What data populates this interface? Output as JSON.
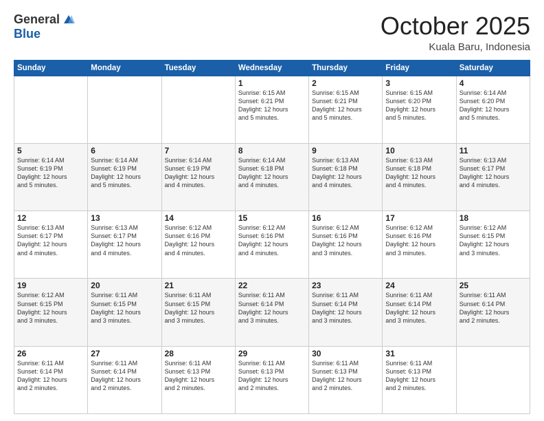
{
  "header": {
    "logo_general": "General",
    "logo_blue": "Blue",
    "month_title": "October 2025",
    "location": "Kuala Baru, Indonesia"
  },
  "days_of_week": [
    "Sunday",
    "Monday",
    "Tuesday",
    "Wednesday",
    "Thursday",
    "Friday",
    "Saturday"
  ],
  "weeks": [
    [
      {
        "day": "",
        "info": ""
      },
      {
        "day": "",
        "info": ""
      },
      {
        "day": "",
        "info": ""
      },
      {
        "day": "1",
        "info": "Sunrise: 6:15 AM\nSunset: 6:21 PM\nDaylight: 12 hours\nand 5 minutes."
      },
      {
        "day": "2",
        "info": "Sunrise: 6:15 AM\nSunset: 6:21 PM\nDaylight: 12 hours\nand 5 minutes."
      },
      {
        "day": "3",
        "info": "Sunrise: 6:15 AM\nSunset: 6:20 PM\nDaylight: 12 hours\nand 5 minutes."
      },
      {
        "day": "4",
        "info": "Sunrise: 6:14 AM\nSunset: 6:20 PM\nDaylight: 12 hours\nand 5 minutes."
      }
    ],
    [
      {
        "day": "5",
        "info": "Sunrise: 6:14 AM\nSunset: 6:19 PM\nDaylight: 12 hours\nand 5 minutes."
      },
      {
        "day": "6",
        "info": "Sunrise: 6:14 AM\nSunset: 6:19 PM\nDaylight: 12 hours\nand 5 minutes."
      },
      {
        "day": "7",
        "info": "Sunrise: 6:14 AM\nSunset: 6:19 PM\nDaylight: 12 hours\nand 4 minutes."
      },
      {
        "day": "8",
        "info": "Sunrise: 6:14 AM\nSunset: 6:18 PM\nDaylight: 12 hours\nand 4 minutes."
      },
      {
        "day": "9",
        "info": "Sunrise: 6:13 AM\nSunset: 6:18 PM\nDaylight: 12 hours\nand 4 minutes."
      },
      {
        "day": "10",
        "info": "Sunrise: 6:13 AM\nSunset: 6:18 PM\nDaylight: 12 hours\nand 4 minutes."
      },
      {
        "day": "11",
        "info": "Sunrise: 6:13 AM\nSunset: 6:17 PM\nDaylight: 12 hours\nand 4 minutes."
      }
    ],
    [
      {
        "day": "12",
        "info": "Sunrise: 6:13 AM\nSunset: 6:17 PM\nDaylight: 12 hours\nand 4 minutes."
      },
      {
        "day": "13",
        "info": "Sunrise: 6:13 AM\nSunset: 6:17 PM\nDaylight: 12 hours\nand 4 minutes."
      },
      {
        "day": "14",
        "info": "Sunrise: 6:12 AM\nSunset: 6:16 PM\nDaylight: 12 hours\nand 4 minutes."
      },
      {
        "day": "15",
        "info": "Sunrise: 6:12 AM\nSunset: 6:16 PM\nDaylight: 12 hours\nand 4 minutes."
      },
      {
        "day": "16",
        "info": "Sunrise: 6:12 AM\nSunset: 6:16 PM\nDaylight: 12 hours\nand 3 minutes."
      },
      {
        "day": "17",
        "info": "Sunrise: 6:12 AM\nSunset: 6:16 PM\nDaylight: 12 hours\nand 3 minutes."
      },
      {
        "day": "18",
        "info": "Sunrise: 6:12 AM\nSunset: 6:15 PM\nDaylight: 12 hours\nand 3 minutes."
      }
    ],
    [
      {
        "day": "19",
        "info": "Sunrise: 6:12 AM\nSunset: 6:15 PM\nDaylight: 12 hours\nand 3 minutes."
      },
      {
        "day": "20",
        "info": "Sunrise: 6:11 AM\nSunset: 6:15 PM\nDaylight: 12 hours\nand 3 minutes."
      },
      {
        "day": "21",
        "info": "Sunrise: 6:11 AM\nSunset: 6:15 PM\nDaylight: 12 hours\nand 3 minutes."
      },
      {
        "day": "22",
        "info": "Sunrise: 6:11 AM\nSunset: 6:14 PM\nDaylight: 12 hours\nand 3 minutes."
      },
      {
        "day": "23",
        "info": "Sunrise: 6:11 AM\nSunset: 6:14 PM\nDaylight: 12 hours\nand 3 minutes."
      },
      {
        "day": "24",
        "info": "Sunrise: 6:11 AM\nSunset: 6:14 PM\nDaylight: 12 hours\nand 3 minutes."
      },
      {
        "day": "25",
        "info": "Sunrise: 6:11 AM\nSunset: 6:14 PM\nDaylight: 12 hours\nand 2 minutes."
      }
    ],
    [
      {
        "day": "26",
        "info": "Sunrise: 6:11 AM\nSunset: 6:14 PM\nDaylight: 12 hours\nand 2 minutes."
      },
      {
        "day": "27",
        "info": "Sunrise: 6:11 AM\nSunset: 6:14 PM\nDaylight: 12 hours\nand 2 minutes."
      },
      {
        "day": "28",
        "info": "Sunrise: 6:11 AM\nSunset: 6:13 PM\nDaylight: 12 hours\nand 2 minutes."
      },
      {
        "day": "29",
        "info": "Sunrise: 6:11 AM\nSunset: 6:13 PM\nDaylight: 12 hours\nand 2 minutes."
      },
      {
        "day": "30",
        "info": "Sunrise: 6:11 AM\nSunset: 6:13 PM\nDaylight: 12 hours\nand 2 minutes."
      },
      {
        "day": "31",
        "info": "Sunrise: 6:11 AM\nSunset: 6:13 PM\nDaylight: 12 hours\nand 2 minutes."
      },
      {
        "day": "",
        "info": ""
      }
    ]
  ]
}
